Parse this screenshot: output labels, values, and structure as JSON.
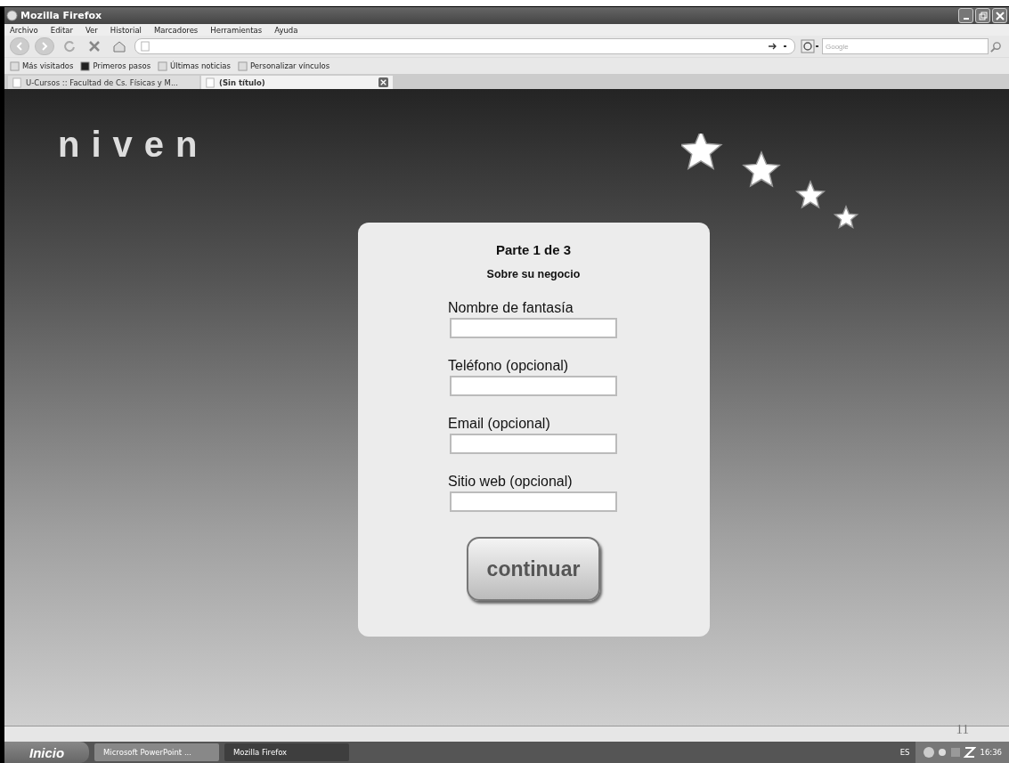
{
  "window": {
    "title": "Mozilla Firefox"
  },
  "menu": [
    "Archivo",
    "Editar",
    "Ver",
    "Historial",
    "Marcadores",
    "Herramientas",
    "Ayuda"
  ],
  "search": {
    "placeholder": "Google"
  },
  "bookmarks": [
    "Más visitados",
    "Primeros pasos",
    "Últimas noticias",
    "Personalizar vínculos"
  ],
  "tabs": [
    {
      "label": "U-Cursos :: Facultad de Cs. Físicas y M...",
      "selected": false
    },
    {
      "label": "(Sin título)",
      "selected": true
    }
  ],
  "page": {
    "logo": "niven",
    "heading": "Parte 1 de 3",
    "subheading": "Sobre su negocio",
    "fields": [
      {
        "label": "Nombre de fantasía"
      },
      {
        "label": "Teléfono (opcional)"
      },
      {
        "label": "Email (opcional)"
      },
      {
        "label": "Sitio web (opcional)"
      }
    ],
    "button": "continuar"
  },
  "slide_number": "11",
  "taskbar": {
    "start": "Inicio",
    "tasks": [
      {
        "label": "Microsoft PowerPoint ...",
        "selected": false
      },
      {
        "label": "Mozilla Firefox",
        "selected": true
      }
    ],
    "language": "ES",
    "clock": "16:36"
  }
}
